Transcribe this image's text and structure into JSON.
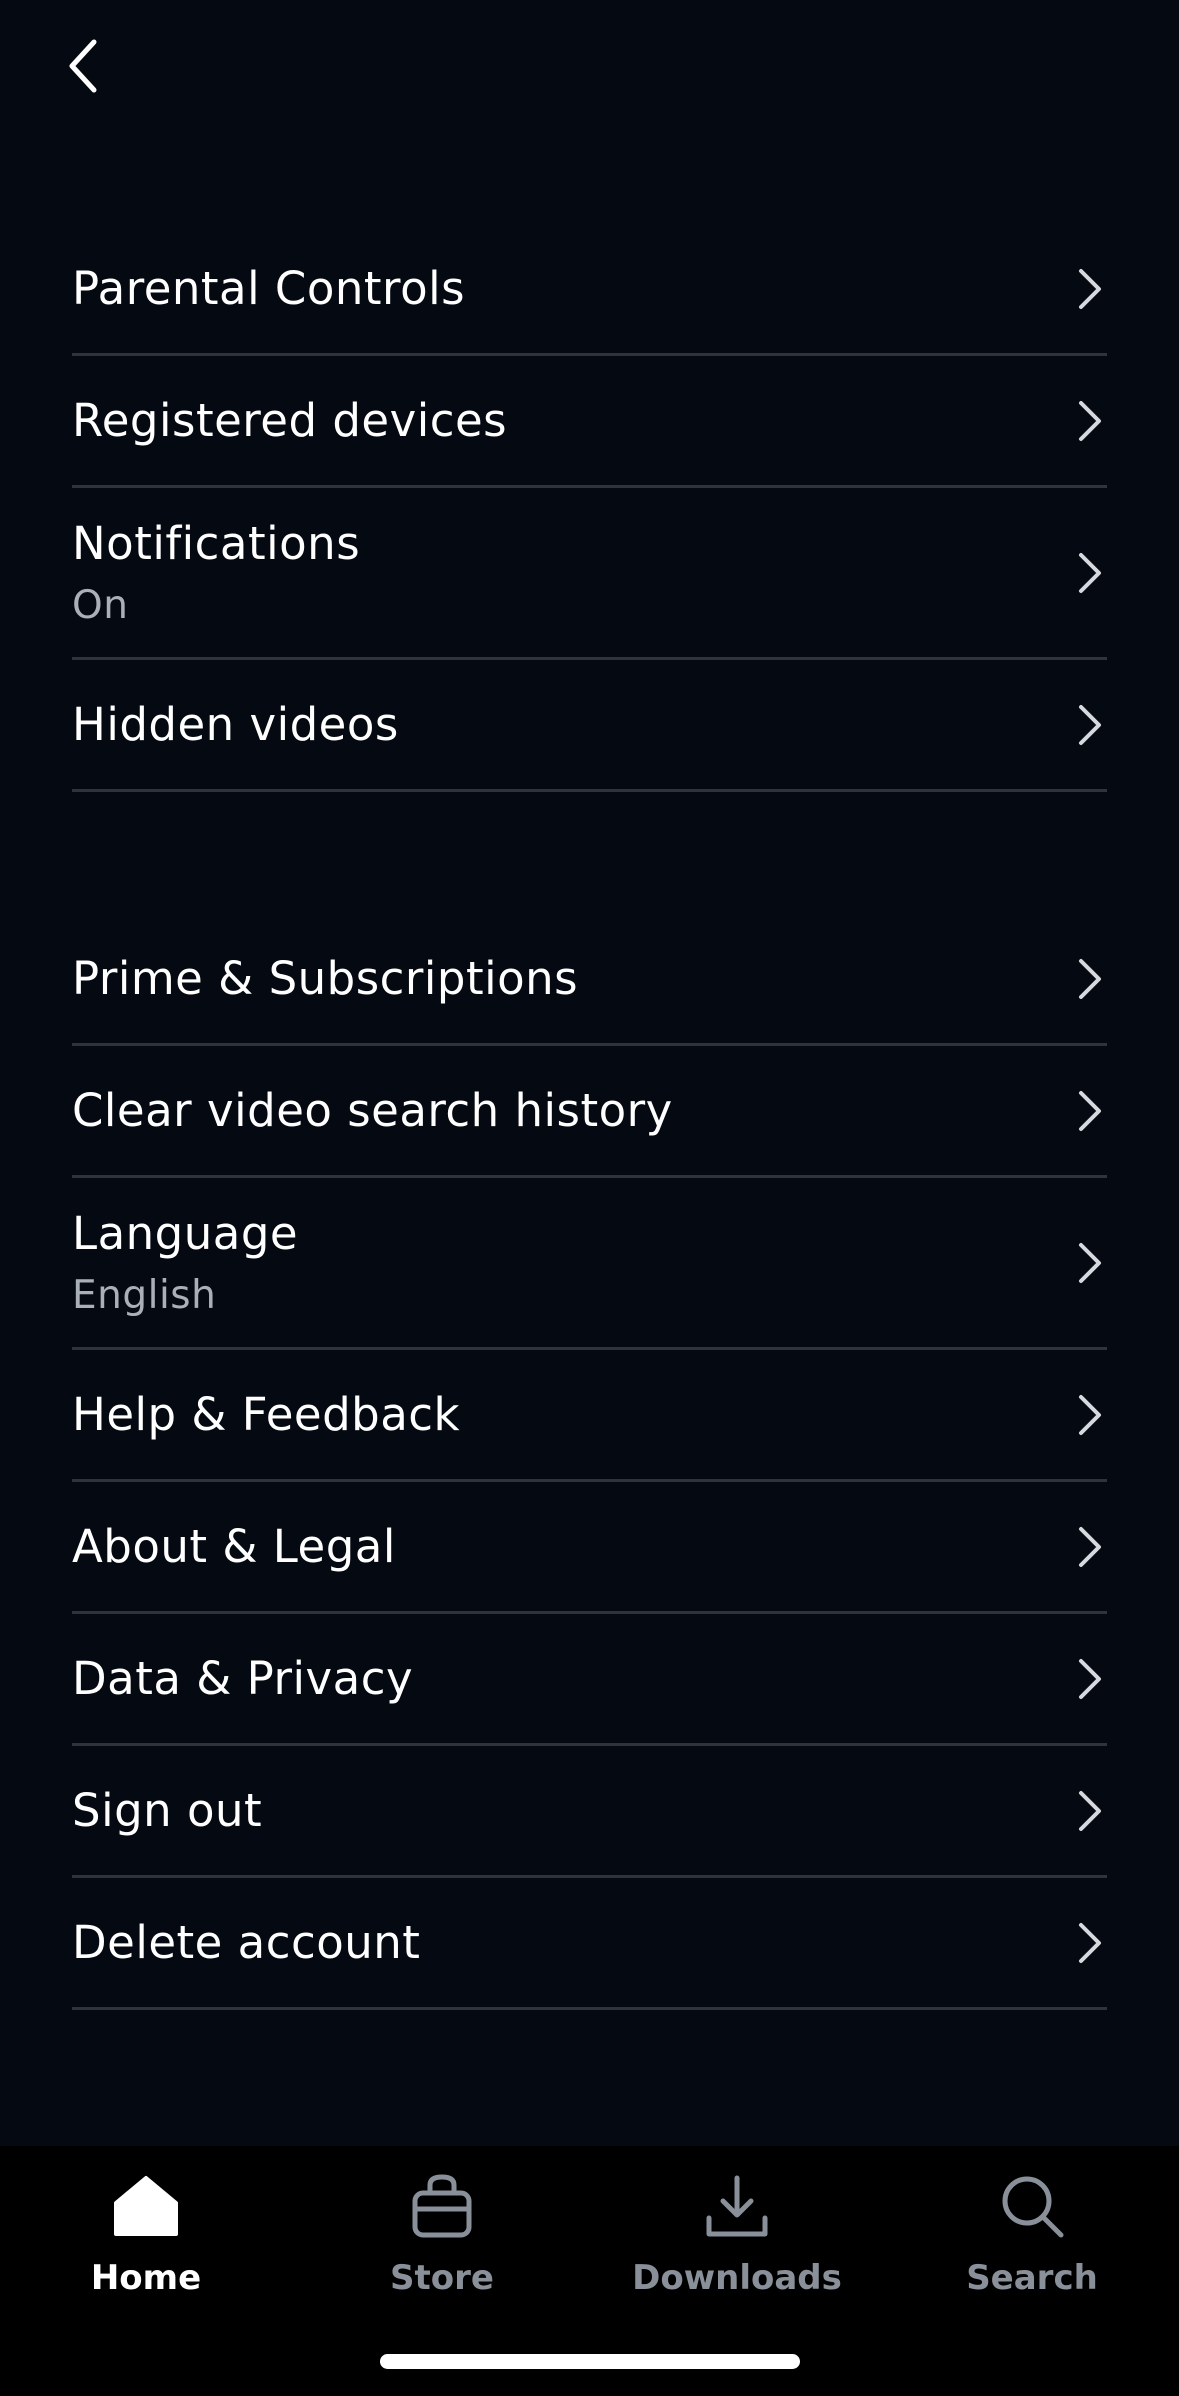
{
  "header": {
    "back_icon": "chevron-left-icon"
  },
  "settings": {
    "group1": [
      {
        "label": "Parental Controls"
      },
      {
        "label": "Registered devices"
      },
      {
        "label": "Notifications",
        "sub": "On"
      },
      {
        "label": "Hidden videos"
      }
    ],
    "group2": [
      {
        "label": "Prime & Subscriptions"
      },
      {
        "label": "Clear video search history"
      },
      {
        "label": "Language",
        "sub": "English"
      },
      {
        "label": "Help & Feedback"
      },
      {
        "label": "About & Legal"
      },
      {
        "label": "Data & Privacy"
      },
      {
        "label": "Sign out"
      },
      {
        "label": "Delete account"
      }
    ]
  },
  "bottom_nav": {
    "items": [
      {
        "label": "Home",
        "icon": "home-icon",
        "active": true
      },
      {
        "label": "Store",
        "icon": "shopping-bag-icon",
        "active": false
      },
      {
        "label": "Downloads",
        "icon": "download-icon",
        "active": false
      },
      {
        "label": "Search",
        "icon": "search-icon",
        "active": false
      }
    ]
  },
  "colors": {
    "background": "#050912",
    "nav_background": "#000000",
    "divider": "#2f343b",
    "secondary_text": "#aab0b8",
    "inactive_nav": "#8a9099"
  }
}
